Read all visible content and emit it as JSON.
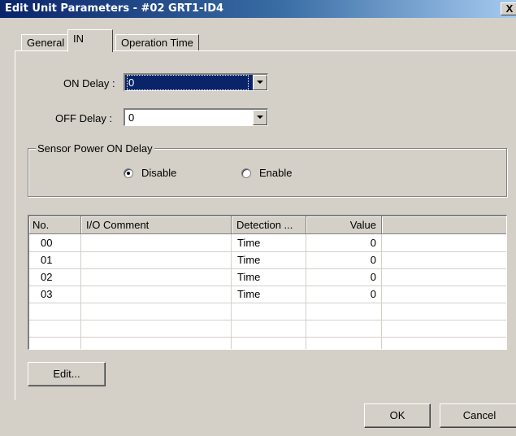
{
  "window": {
    "title": "Edit Unit Parameters - #02 GRT1-ID4",
    "close_label": "X"
  },
  "tabs": [
    {
      "label": "General",
      "active": false
    },
    {
      "label": "IN",
      "active": true
    },
    {
      "label": "Operation Time",
      "active": false
    }
  ],
  "on_delay": {
    "label": "ON Delay :",
    "value": "0"
  },
  "off_delay": {
    "label": "OFF Delay :",
    "value": "0"
  },
  "sensor_power": {
    "group_label": "Sensor Power ON Delay",
    "options": [
      {
        "label": "Disable",
        "selected": true
      },
      {
        "label": "Enable",
        "selected": false
      }
    ]
  },
  "table": {
    "columns": [
      "No.",
      "I/O Comment",
      "Detection ...",
      "Value"
    ],
    "rows": [
      {
        "no": "00",
        "comment": "",
        "detection": "Time",
        "value": "0"
      },
      {
        "no": "01",
        "comment": "",
        "detection": "Time",
        "value": "0"
      },
      {
        "no": "02",
        "comment": "",
        "detection": "Time",
        "value": "0"
      },
      {
        "no": "03",
        "comment": "",
        "detection": "Time",
        "value": "0"
      }
    ]
  },
  "buttons": {
    "edit": "Edit...",
    "ok": "OK",
    "cancel": "Cancel"
  }
}
